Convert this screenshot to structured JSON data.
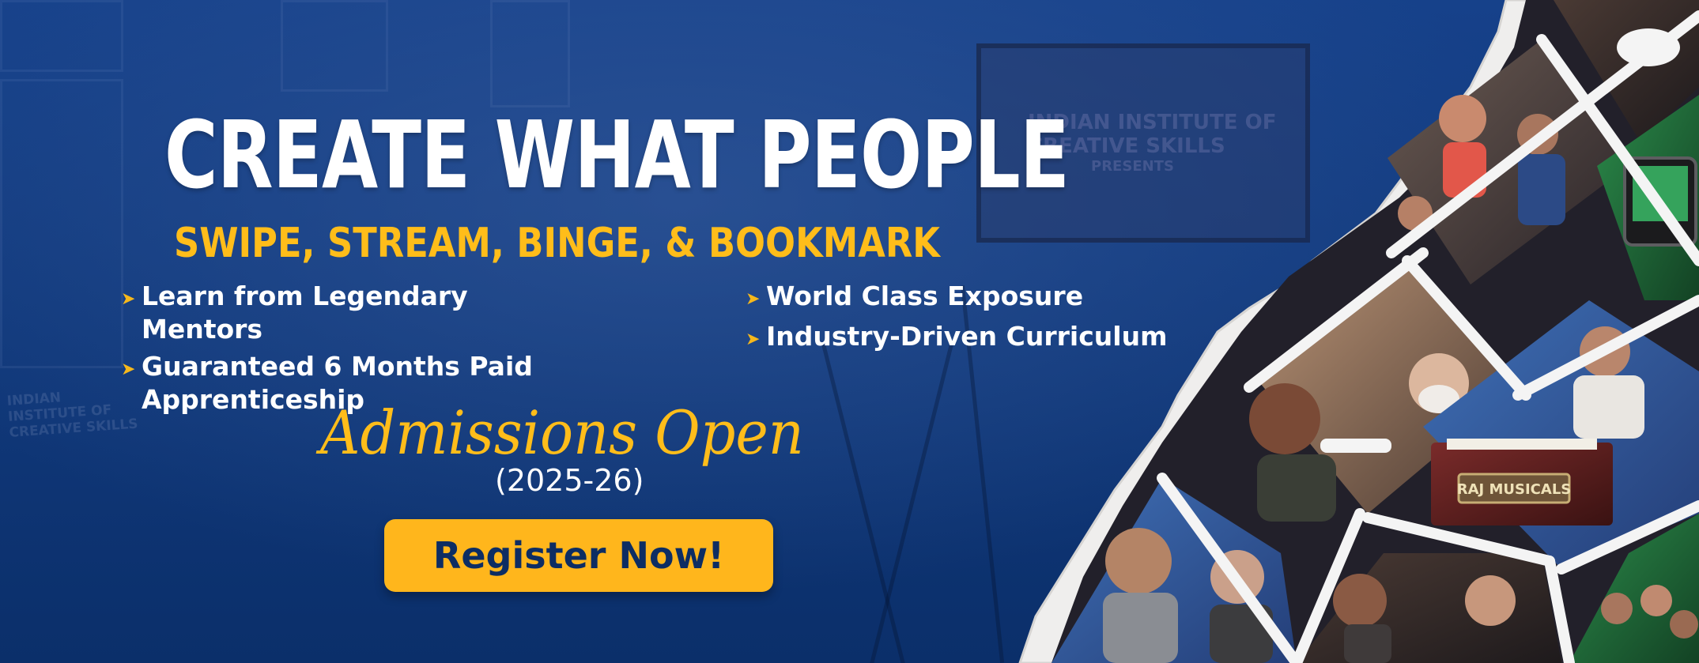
{
  "banner": {
    "headline": "CREATE WHAT PEOPLE",
    "subhead": "SWIPE, STREAM, BINGE, & BOOKMARK",
    "features_left": [
      "Learn from Legendary Mentors",
      "Guaranteed 6 Months Paid Apprenticeship"
    ],
    "features_right": [
      "World Class Exposure",
      "Industry-Driven Curriculum"
    ],
    "admissions": "Admissions Open",
    "year": "(2025-26)",
    "register_label": "Register Now!",
    "bullet_icon": "arrow-right-icon"
  },
  "background": {
    "screen_text": "INDIAN INSTITUTE OF CREATIVE SKILLS",
    "screen_subtext": "PRESENTS",
    "wall_text": "INDIAN INSTITUTE OF CREATIVE SKILLS"
  },
  "photo": {
    "harmonium_label": "RAJ MUSICALS"
  },
  "colors": {
    "navy": "#10387a",
    "gold": "#ffb61c",
    "white": "#ffffff"
  }
}
